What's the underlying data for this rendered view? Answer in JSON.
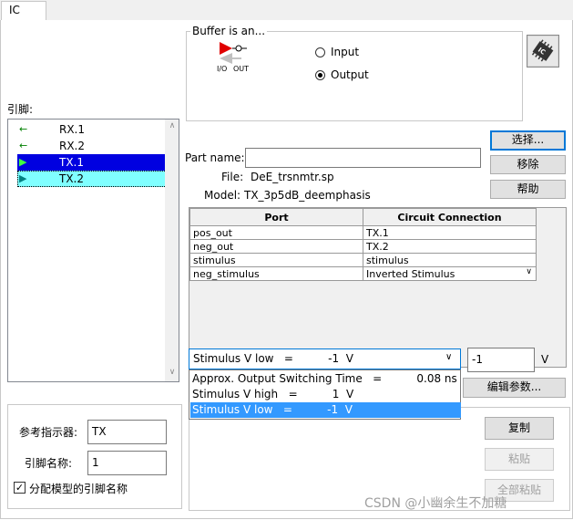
{
  "tab": {
    "label": "IC"
  },
  "buffer": {
    "group_label": "Buffer is an...",
    "icon_caption_left": "I/O",
    "icon_caption_right": "OUT",
    "options": [
      {
        "label": "Input",
        "selected": false
      },
      {
        "label": "Output",
        "selected": true
      }
    ]
  },
  "pins": {
    "label": "引脚:",
    "items": [
      {
        "name": "RX.1",
        "state": "normal"
      },
      {
        "name": "RX.2",
        "state": "normal"
      },
      {
        "name": "TX.1",
        "state": "selected"
      },
      {
        "name": "TX.2",
        "state": "focused"
      }
    ]
  },
  "part": {
    "name_label": "Part name:",
    "name_value": "",
    "file_label": "File:",
    "file_value": "DeE_trsnmtr.sp",
    "model_label": "Model:",
    "model_value": "TX_3p5dB_deemphasis"
  },
  "buttons": {
    "select": "选择...",
    "remove": "移除",
    "help": "帮助",
    "edit_params": "编辑参数...",
    "copy": "复制",
    "paste": "粘贴",
    "paste_all": "全部粘贴"
  },
  "table": {
    "headers": [
      "Port",
      "Circuit Connection"
    ],
    "rows": [
      {
        "port": "pos_out",
        "connection": "TX.1"
      },
      {
        "port": "neg_out",
        "connection": "TX.2"
      },
      {
        "port": "stimulus",
        "connection": "stimulus"
      },
      {
        "port": "neg_stimulus",
        "connection": "Inverted Stimulus"
      }
    ]
  },
  "param": {
    "selected": "Stimulus V low   =          -1  V",
    "value": "-1",
    "unit": "V",
    "options": [
      {
        "label": "Approx. Output Switching Time   =          0.08 ns",
        "highlighted": false
      },
      {
        "label": "Stimulus V high   =          1  V",
        "highlighted": false
      },
      {
        "label": "Stimulus V low   =          -1  V",
        "highlighted": true
      }
    ]
  },
  "ref": {
    "designator_label": "参考指示器:",
    "designator_value": "TX",
    "pin_name_label": "引脚名称:",
    "pin_name_value": "1",
    "assign_label": "分配模型的引脚名称",
    "assign_checked": true
  },
  "watermark": "CSDN @小幽余生不加糖",
  "colors": {
    "selection_blue": "#0000e0",
    "focus_cyan": "#80ffff",
    "dropdown_highlight": "#3399ff",
    "accent_border": "#0078d7"
  }
}
